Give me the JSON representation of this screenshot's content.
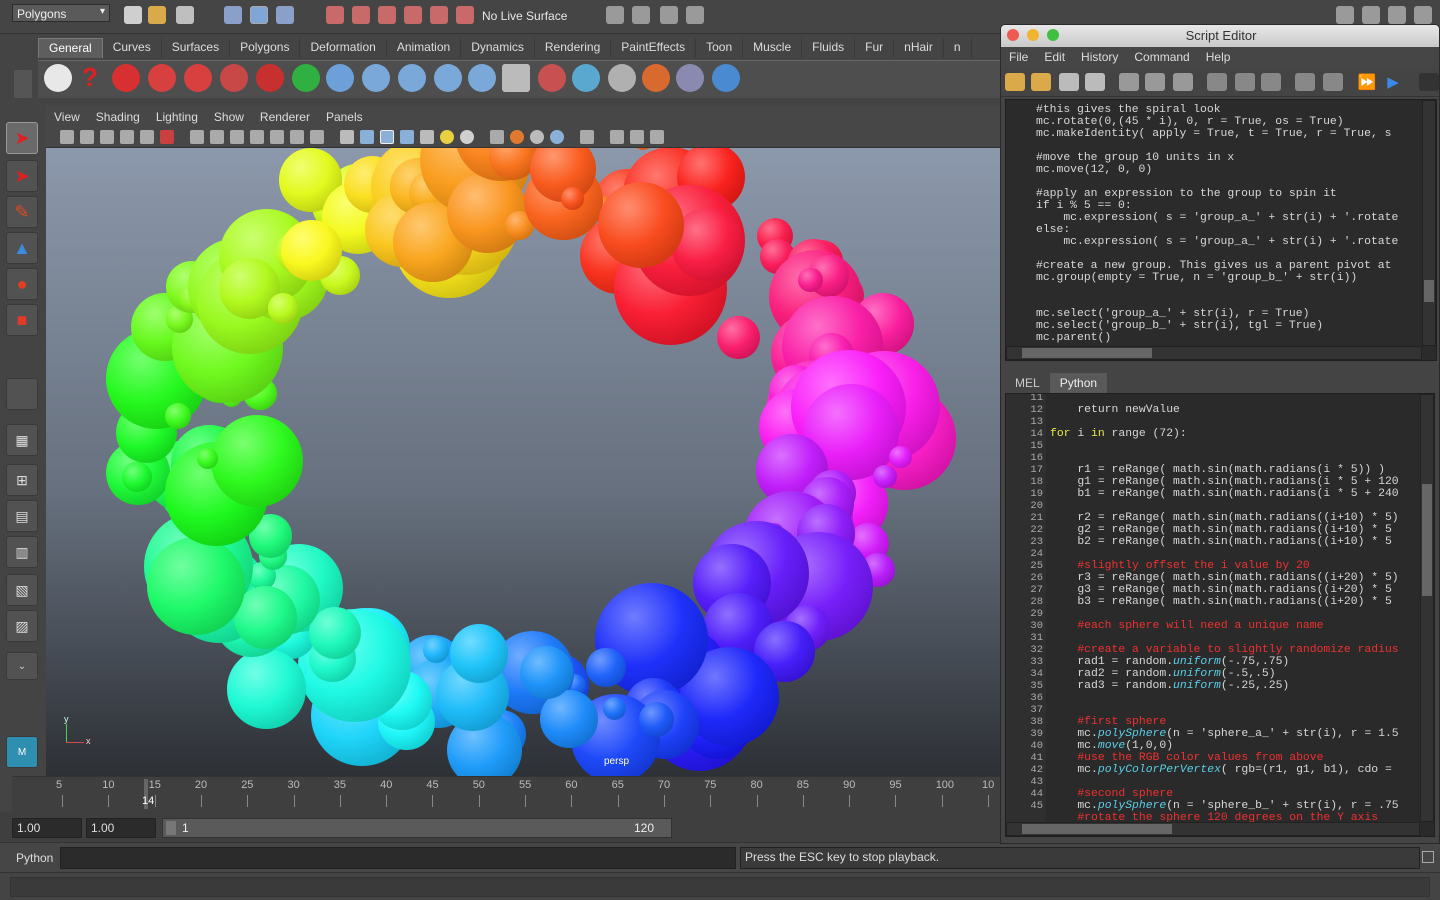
{
  "top": {
    "mode": "Polygons",
    "live_surface": "No Live Surface"
  },
  "shelf": {
    "tabs": [
      "General",
      "Curves",
      "Surfaces",
      "Polygons",
      "Deformation",
      "Animation",
      "Dynamics",
      "Rendering",
      "PaintEffects",
      "Toon",
      "Muscle",
      "Fluids",
      "Fur",
      "nHair",
      "n"
    ],
    "active": "General"
  },
  "viewport": {
    "menus": [
      "View",
      "Shading",
      "Lighting",
      "Show",
      "Renderer",
      "Panels"
    ],
    "camera_label": "persp",
    "axis_y": "y",
    "axis_x": "x"
  },
  "timeline": {
    "ticks": [
      "5",
      "10",
      "15",
      "20",
      "25",
      "30",
      "35",
      "40",
      "45",
      "50",
      "55",
      "60",
      "65",
      "70",
      "75",
      "80",
      "85",
      "90",
      "95",
      "100",
      "10"
    ],
    "current_frame": "14"
  },
  "range": {
    "start_field": "1.00",
    "start_field2": "1.00",
    "slider_start": "1",
    "slider_end": "120"
  },
  "status": {
    "language": "Python",
    "message": "Press the ESC key to stop playback."
  },
  "script_editor": {
    "title": "Script Editor",
    "menus": [
      "File",
      "Edit",
      "History",
      "Command",
      "Help"
    ],
    "tabs": [
      "MEL",
      "Python"
    ],
    "active_tab": "Python",
    "history_lines": [
      "#this gives the spiral look",
      "mc.rotate(0,(45 * i), 0, r = True, os = True)",
      "mc.makeIdentity( apply = True, t = True, r = True, s",
      "",
      "#move the group 10 units in x",
      "mc.move(12, 0, 0)",
      "",
      "#apply an expression to the group to spin it",
      "if i % 5 == 0:",
      "    mc.expression( s = 'group_a_' + str(i) + '.rotate",
      "else:",
      "    mc.expression( s = 'group_a_' + str(i) + '.rotate",
      "",
      "#create a new group. This gives us a parent pivot at",
      "mc.group(empty = True, n = 'group_b_' + str(i))",
      "",
      "",
      "mc.select('group_a_' + str(i), r = True)",
      "mc.select('group_b_' + str(i), tgl = True)",
      "mc.parent()"
    ],
    "line_numbers": [
      "11",
      "12",
      "13",
      "14",
      "15",
      "16",
      "17",
      "18",
      "19",
      "20",
      "21",
      "22",
      "23",
      "24",
      "25",
      "26",
      "27",
      "28",
      "29",
      "30",
      "31",
      "32",
      "33",
      "34",
      "35",
      "36",
      "37",
      "38",
      "39",
      "40",
      "41",
      "42",
      "43",
      "44",
      "45"
    ],
    "code": {
      "l12": "",
      "l13_kw1": "for",
      "l13_mid": " i ",
      "l13_kw2": "in",
      "l13_rest": " range (72):",
      "l16": "    r1 = reRange( math.sin(math.radians(i * 5)) )",
      "l17": "    g1 = reRange( math.sin(math.radians(i * 5 + 120",
      "l18": "    b1 = reRange( math.sin(math.radians(i * 5 + 240",
      "l20": "    r2 = reRange( math.sin(math.radians((i+10) * 5)",
      "l21": "    g2 = reRange( math.sin(math.radians((i+10) * 5",
      "l22": "    b2 = reRange( math.sin(math.radians((i+10) * 5",
      "l24": "    #slightly offset the i value by 20",
      "l25": "    r3 = reRange( math.sin(math.radians((i+20) * 5)",
      "l26": "    g3 = reRange( math.sin(math.radians((i+20) * 5",
      "l27": "    b3 = reRange( math.sin(math.radians((i+20) * 5",
      "l29": "    #each sphere will need a unique name",
      "l31": "    #create a variable to slightly randomize radius",
      "l32a": "    rad1 = random.",
      "l32fn": "uniform",
      "l32b": "(-.75,.75)",
      "l33a": "    rad2 = random.",
      "l33fn": "uniform",
      "l33b": "(-.5,.5)",
      "l34a": "    rad3 = random.",
      "l34fn": "uniform",
      "l34b": "(-.25,.25)",
      "l37": "    #first sphere",
      "l38a": "    mc.",
      "l38fn": "polySphere",
      "l38b": "(n = 'sphere_a_' + str(i), r = 1.5",
      "l39a": "    mc.",
      "l39fn": "move",
      "l39b": "(1,0,0)",
      "l40": "    #use the RGB color values from above",
      "l41a": "    mc.",
      "l41fn": "polyColorPerVertex",
      "l41b": "( rgb=(r1, g1, b1), cdo =",
      "l43": "    #second sphere",
      "l44a": "    mc.",
      "l44fn": "polySphere",
      "l44b": "(n = 'sphere_b_' + str(i), r = .75",
      "l45": "    #rotate the sphere 120 degrees on the Y axis"
    }
  },
  "colors": {
    "comment": "#f03030",
    "keyword": "#e8e84a",
    "function": "#5ad0e8"
  }
}
